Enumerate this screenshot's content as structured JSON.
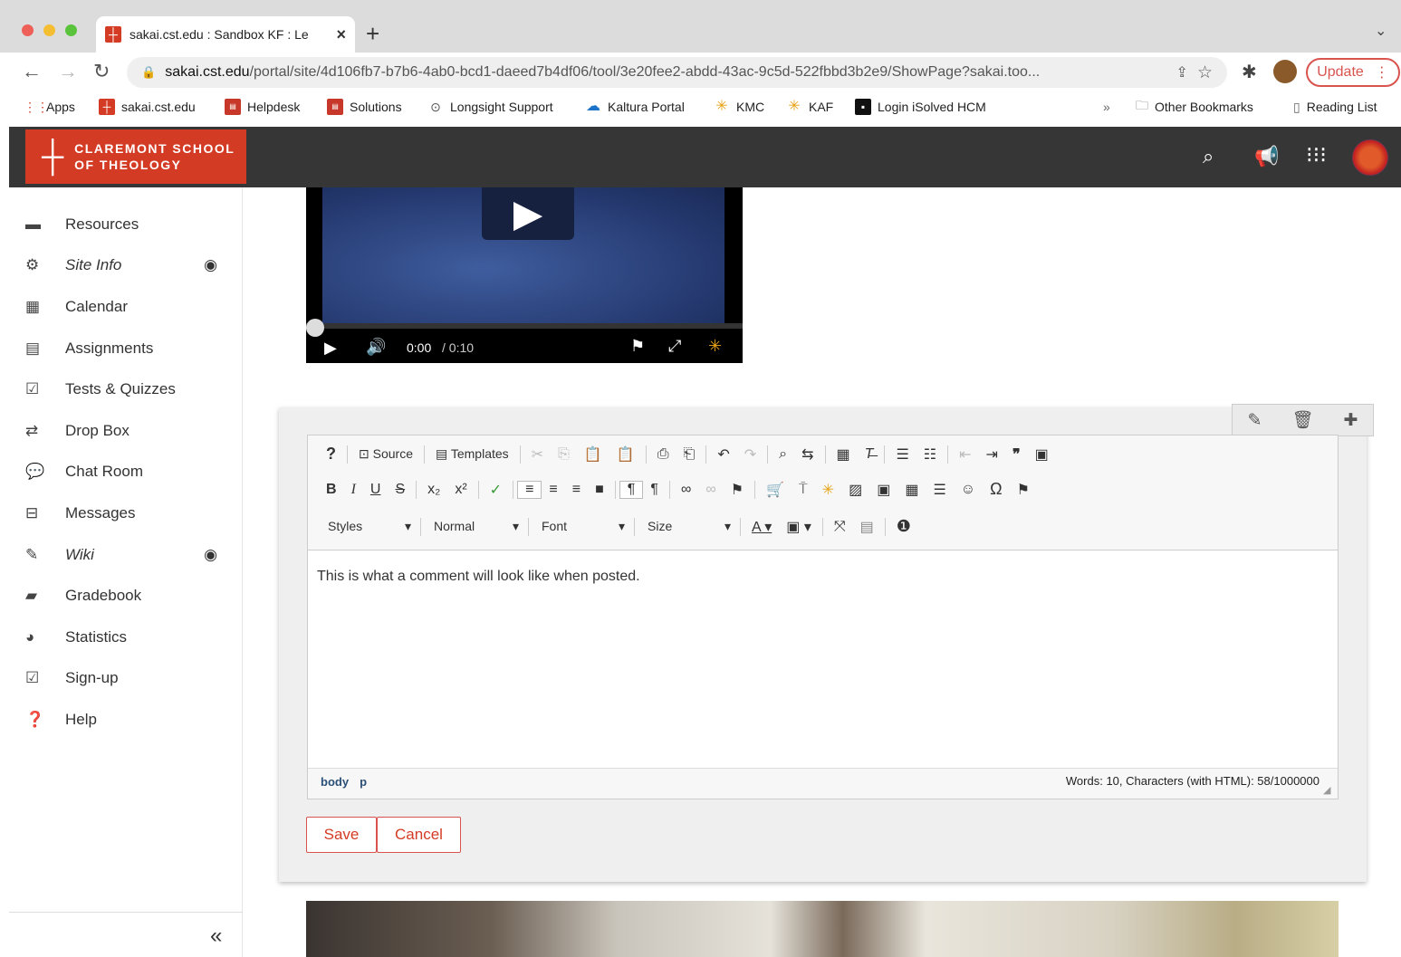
{
  "browser": {
    "tab_title": "sakai.cst.edu : Sandbox KF : Le",
    "tab_close": "×",
    "new_tab": "+",
    "tab_menu": "⌄",
    "url_domain": "sakai.cst.edu",
    "url_path": "/portal/site/4d106fb7-b7b6-4ab0-bcd1-daeed7b4df06/tool/3e20fee2-abdd-43ac-9c5d-522fbbd3b2e9/ShowPage?sakai.too...",
    "update_label": "Update",
    "bookmarks": [
      "Apps",
      "sakai.cst.edu",
      "Helpdesk",
      "Solutions",
      "Longsight Support",
      "Kaltura Portal",
      "KMC",
      "KAF",
      "Login iSolved HCM"
    ],
    "bookmarks_overflow": "»",
    "other_bookmarks": "Other Bookmarks",
    "reading_list": "Reading List"
  },
  "site": {
    "logo_text": "CLAREMONT SCHOOL\nOF THEOLOGY"
  },
  "sidebar": {
    "items": [
      {
        "label": "Resources",
        "icon": "folder-icon"
      },
      {
        "label": "Site Info",
        "icon": "gear-icon",
        "hidden": true
      },
      {
        "label": "Calendar",
        "icon": "calendar-icon"
      },
      {
        "label": "Assignments",
        "icon": "file-icon"
      },
      {
        "label": "Tests & Quizzes",
        "icon": "checkbox-icon"
      },
      {
        "label": "Drop Box",
        "icon": "exchange-icon"
      },
      {
        "label": "Chat Room",
        "icon": "comments-icon"
      },
      {
        "label": "Messages",
        "icon": "inbox-icon"
      },
      {
        "label": "Wiki",
        "icon": "edit-icon",
        "hidden": true
      },
      {
        "label": "Gradebook",
        "icon": "book-icon"
      },
      {
        "label": "Statistics",
        "icon": "pie-chart-icon"
      },
      {
        "label": "Sign-up",
        "icon": "calendar-check-icon"
      },
      {
        "label": "Help",
        "icon": "question-icon"
      }
    ],
    "collapse": "«"
  },
  "video": {
    "current_time": "0:00",
    "duration": "/ 0:10"
  },
  "editor": {
    "toolbar": {
      "help": "?",
      "source": "Source",
      "templates": "Templates",
      "styles": "Styles",
      "format": "Normal",
      "font": "Font",
      "size": "Size"
    },
    "content": "This is what a comment will look like when posted.",
    "path": [
      "body",
      "p"
    ],
    "word_count": "Words: 10, Characters (with HTML): 58/1000000"
  },
  "actions": {
    "save": "Save",
    "cancel": "Cancel"
  }
}
